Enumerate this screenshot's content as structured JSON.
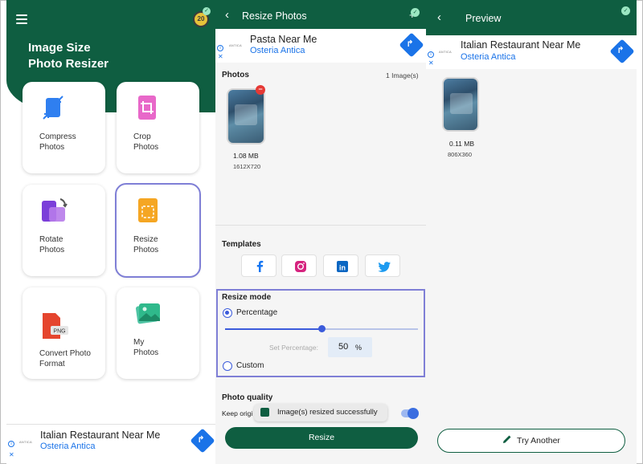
{
  "home": {
    "app_title_line1": "Image Size",
    "app_title_line2": "Photo Resizer",
    "avatar_text": "20",
    "tiles": [
      {
        "line1": "Compress",
        "line2": "Photos",
        "icon": "compress-icon"
      },
      {
        "line1": "Crop",
        "line2": "Photos",
        "icon": "crop-icon"
      },
      {
        "line1": "Rotate",
        "line2": "Photos",
        "icon": "rotate-icon"
      },
      {
        "line1": "Resize",
        "line2": "Photos",
        "icon": "resize-icon"
      },
      {
        "line1": "Convert Photo",
        "line2": "Format",
        "icon": "png-icon",
        "badge": "PNG"
      },
      {
        "line1": "My",
        "line2": "Photos",
        "icon": "gallery-icon"
      }
    ],
    "ad": {
      "title": "Italian Restaurant Near Me",
      "subtitle": "Osteria Antica",
      "logo": "ANTICA"
    }
  },
  "resize": {
    "header_title": "Resize Photos",
    "ad": {
      "title": "Pasta Near Me",
      "subtitle": "Osteria Antica",
      "logo": "ANTICA"
    },
    "photos_label": "Photos",
    "photos_count": "1 Image(s)",
    "photo": {
      "size": "1.08 MB",
      "dims": "1612X720"
    },
    "templates_label": "Templates",
    "templates": [
      "facebook-icon",
      "instagram-icon",
      "linkedin-icon",
      "twitter-icon"
    ],
    "resize_mode_label": "Resize mode",
    "percentage_label": "Percentage",
    "set_percentage_label": "Set Percentage:",
    "percentage_value": "50",
    "percentage_unit": "%",
    "slider_fraction": 0.5,
    "custom_label": "Custom",
    "photo_quality_label": "Photo quality",
    "keep_original_label": "Keep origi",
    "toast": "Image(s) resized successfully",
    "resize_button": "Resize"
  },
  "preview": {
    "header_title": "Preview",
    "ad": {
      "title": "Italian Restaurant Near Me",
      "subtitle": "Osteria Antica",
      "logo": "ANTICA"
    },
    "photo": {
      "size": "0.11 MB",
      "dims": "806X360"
    },
    "try_another": "Try Another"
  },
  "colors": {
    "primary": "#0f5e41",
    "accent": "#3b5bdb",
    "highlight": "#7f7fd6",
    "link": "#1a73e8"
  }
}
